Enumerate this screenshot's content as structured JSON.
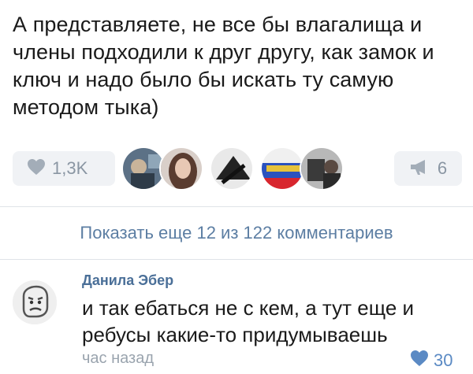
{
  "post": {
    "text": "А представляете, не все бы влагалища и члены подходили к друг другу, как замок и ключ и надо было бы искать ту самую методом тыка)"
  },
  "actions": {
    "like_count": "1,3K",
    "share_count": "6",
    "like_icon": "heart-icon",
    "share_icon": "megaphone-icon"
  },
  "show_more": {
    "label": "Показать еще 12 из 122 комментариев"
  },
  "comment": {
    "author": "Данила Эбер",
    "text": "и так ебаться не с кем, а тут еще и ребусы какие-то придумываешь",
    "time": "час назад",
    "like_count": "30"
  },
  "colors": {
    "link": "#5c7ea3",
    "muted": "#8a96a3",
    "liked": "#5b8ac4"
  }
}
